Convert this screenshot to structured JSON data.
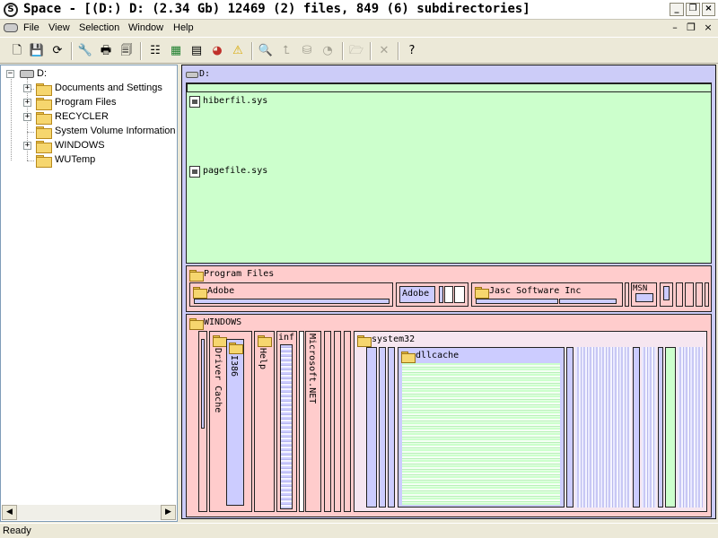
{
  "window": {
    "title": "Space - [(D:) D: (2.34 Gb) 12469 (2) files, 849 (6) subdirectories]"
  },
  "menu": [
    "File",
    "View",
    "Selection",
    "Window",
    "Help"
  ],
  "toolbar": [
    {
      "icon": "new-icon"
    },
    {
      "icon": "save-icon"
    },
    {
      "icon": "refresh-icon"
    },
    {
      "icon": "wrench-icon"
    },
    {
      "icon": "print-icon"
    },
    {
      "icon": "print-preview-icon"
    },
    {
      "icon": "tree-view-icon"
    },
    {
      "icon": "map-view-icon"
    },
    {
      "icon": "table-view-icon"
    },
    {
      "icon": "pie-chart-icon"
    },
    {
      "icon": "warning-icon"
    },
    {
      "icon": "zoom-icon"
    },
    {
      "icon": "up-icon"
    },
    {
      "icon": "disk-icon"
    },
    {
      "icon": "gauge-icon"
    },
    {
      "icon": "open-folder-icon"
    },
    {
      "icon": "delete-icon"
    },
    {
      "icon": "help-icon"
    }
  ],
  "tree": {
    "root": "D:",
    "items": [
      {
        "label": "Documents and Settings"
      },
      {
        "label": "Program Files"
      },
      {
        "label": "RECYCLER"
      },
      {
        "label": "System Volume Information"
      },
      {
        "label": "WINDOWS"
      },
      {
        "label": "WUTemp"
      }
    ]
  },
  "viz": {
    "root": "D:",
    "files": [
      "hiberfil.sys",
      "pagefile.sys"
    ],
    "program_files": {
      "label": "Program Files",
      "children": [
        "Adobe",
        "Adobe",
        "Jasc Software Inc",
        "MSN"
      ]
    },
    "windows": {
      "label": "WINDOWS",
      "children": [
        "Driver Cache",
        "I386",
        "Help",
        "inf",
        "Microsoft.NET",
        "system32",
        "dllcache"
      ]
    }
  },
  "status": "Ready",
  "colors": {
    "files": "#ccffcc",
    "folders": "#ffcccc",
    "subfolders": "#ccccff",
    "tree_border": "#7f9db9"
  }
}
